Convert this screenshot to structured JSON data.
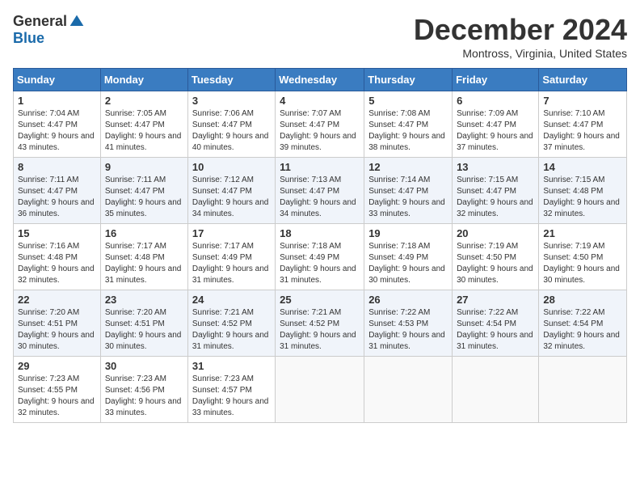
{
  "logo": {
    "general": "General",
    "blue": "Blue"
  },
  "title": "December 2024",
  "subtitle": "Montross, Virginia, United States",
  "days_header": [
    "Sunday",
    "Monday",
    "Tuesday",
    "Wednesday",
    "Thursday",
    "Friday",
    "Saturday"
  ],
  "weeks": [
    [
      {
        "day": "1",
        "sunrise": "7:04 AM",
        "sunset": "4:47 PM",
        "daylight": "9 hours and 43 minutes."
      },
      {
        "day": "2",
        "sunrise": "7:05 AM",
        "sunset": "4:47 PM",
        "daylight": "9 hours and 41 minutes."
      },
      {
        "day": "3",
        "sunrise": "7:06 AM",
        "sunset": "4:47 PM",
        "daylight": "9 hours and 40 minutes."
      },
      {
        "day": "4",
        "sunrise": "7:07 AM",
        "sunset": "4:47 PM",
        "daylight": "9 hours and 39 minutes."
      },
      {
        "day": "5",
        "sunrise": "7:08 AM",
        "sunset": "4:47 PM",
        "daylight": "9 hours and 38 minutes."
      },
      {
        "day": "6",
        "sunrise": "7:09 AM",
        "sunset": "4:47 PM",
        "daylight": "9 hours and 37 minutes."
      },
      {
        "day": "7",
        "sunrise": "7:10 AM",
        "sunset": "4:47 PM",
        "daylight": "9 hours and 37 minutes."
      }
    ],
    [
      {
        "day": "8",
        "sunrise": "7:11 AM",
        "sunset": "4:47 PM",
        "daylight": "9 hours and 36 minutes."
      },
      {
        "day": "9",
        "sunrise": "7:11 AM",
        "sunset": "4:47 PM",
        "daylight": "9 hours and 35 minutes."
      },
      {
        "day": "10",
        "sunrise": "7:12 AM",
        "sunset": "4:47 PM",
        "daylight": "9 hours and 34 minutes."
      },
      {
        "day": "11",
        "sunrise": "7:13 AM",
        "sunset": "4:47 PM",
        "daylight": "9 hours and 34 minutes."
      },
      {
        "day": "12",
        "sunrise": "7:14 AM",
        "sunset": "4:47 PM",
        "daylight": "9 hours and 33 minutes."
      },
      {
        "day": "13",
        "sunrise": "7:15 AM",
        "sunset": "4:47 PM",
        "daylight": "9 hours and 32 minutes."
      },
      {
        "day": "14",
        "sunrise": "7:15 AM",
        "sunset": "4:48 PM",
        "daylight": "9 hours and 32 minutes."
      }
    ],
    [
      {
        "day": "15",
        "sunrise": "7:16 AM",
        "sunset": "4:48 PM",
        "daylight": "9 hours and 32 minutes."
      },
      {
        "day": "16",
        "sunrise": "7:17 AM",
        "sunset": "4:48 PM",
        "daylight": "9 hours and 31 minutes."
      },
      {
        "day": "17",
        "sunrise": "7:17 AM",
        "sunset": "4:49 PM",
        "daylight": "9 hours and 31 minutes."
      },
      {
        "day": "18",
        "sunrise": "7:18 AM",
        "sunset": "4:49 PM",
        "daylight": "9 hours and 31 minutes."
      },
      {
        "day": "19",
        "sunrise": "7:18 AM",
        "sunset": "4:49 PM",
        "daylight": "9 hours and 30 minutes."
      },
      {
        "day": "20",
        "sunrise": "7:19 AM",
        "sunset": "4:50 PM",
        "daylight": "9 hours and 30 minutes."
      },
      {
        "day": "21",
        "sunrise": "7:19 AM",
        "sunset": "4:50 PM",
        "daylight": "9 hours and 30 minutes."
      }
    ],
    [
      {
        "day": "22",
        "sunrise": "7:20 AM",
        "sunset": "4:51 PM",
        "daylight": "9 hours and 30 minutes."
      },
      {
        "day": "23",
        "sunrise": "7:20 AM",
        "sunset": "4:51 PM",
        "daylight": "9 hours and 30 minutes."
      },
      {
        "day": "24",
        "sunrise": "7:21 AM",
        "sunset": "4:52 PM",
        "daylight": "9 hours and 31 minutes."
      },
      {
        "day": "25",
        "sunrise": "7:21 AM",
        "sunset": "4:52 PM",
        "daylight": "9 hours and 31 minutes."
      },
      {
        "day": "26",
        "sunrise": "7:22 AM",
        "sunset": "4:53 PM",
        "daylight": "9 hours and 31 minutes."
      },
      {
        "day": "27",
        "sunrise": "7:22 AM",
        "sunset": "4:54 PM",
        "daylight": "9 hours and 31 minutes."
      },
      {
        "day": "28",
        "sunrise": "7:22 AM",
        "sunset": "4:54 PM",
        "daylight": "9 hours and 32 minutes."
      }
    ],
    [
      {
        "day": "29",
        "sunrise": "7:23 AM",
        "sunset": "4:55 PM",
        "daylight": "9 hours and 32 minutes."
      },
      {
        "day": "30",
        "sunrise": "7:23 AM",
        "sunset": "4:56 PM",
        "daylight": "9 hours and 33 minutes."
      },
      {
        "day": "31",
        "sunrise": "7:23 AM",
        "sunset": "4:57 PM",
        "daylight": "9 hours and 33 minutes."
      },
      null,
      null,
      null,
      null
    ]
  ],
  "labels": {
    "sunrise": "Sunrise: ",
    "sunset": "Sunset: ",
    "daylight": "Daylight: "
  }
}
